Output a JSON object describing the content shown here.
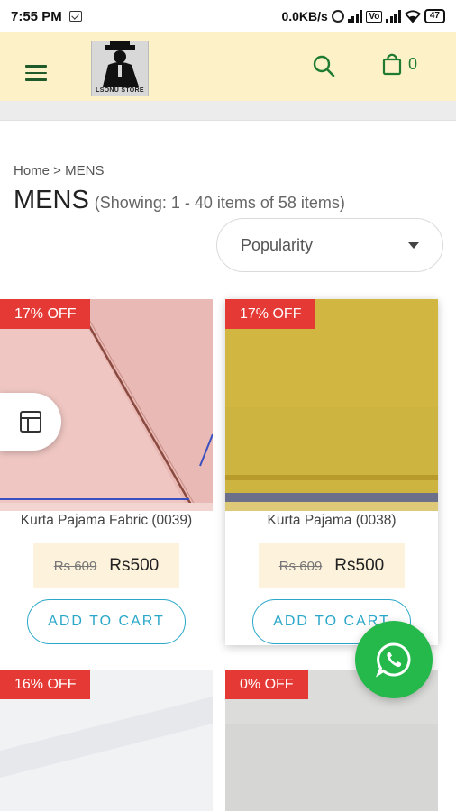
{
  "status_bar": {
    "time": "7:55 PM",
    "network_speed": "0.0KB/s",
    "volte": "Vo",
    "battery": "47"
  },
  "header": {
    "logo_text": "LSONU STORE",
    "cart_count": "0",
    "accent_color": "#1f7a32",
    "background_color": "#fdf2c7"
  },
  "breadcrumb": "Home > MENS",
  "page": {
    "title": "MENS",
    "showing": "(Showing: 1 - 40 items of 58 items)"
  },
  "sort": {
    "selected": "Popularity"
  },
  "products": [
    {
      "badge": "17% OFF",
      "name": "Kurta Pajama Fabric (0039)",
      "old_price": "Rs 609",
      "price": "Rs500",
      "button": "ADD TO CART",
      "color": "#e8b7b3"
    },
    {
      "badge": "17% OFF",
      "name": "Kurta Pajama (0038)",
      "old_price": "Rs 609",
      "price": "Rs500",
      "button": "ADD TO CART",
      "color": "#cdb33f"
    },
    {
      "badge": "16% OFF",
      "color": "#f1f2f4"
    },
    {
      "badge": "0% OFF",
      "color": "#d6d6d4"
    }
  ],
  "colors": {
    "badge": "#e53935",
    "add_to_cart": "#2aa7c9",
    "whatsapp": "#25b94c"
  },
  "icons": {
    "menu": "hamburger-menu-icon",
    "search": "search-icon",
    "cart": "shopping-bag-icon",
    "layout": "grid-layout-icon",
    "whatsapp": "whatsapp-icon"
  }
}
